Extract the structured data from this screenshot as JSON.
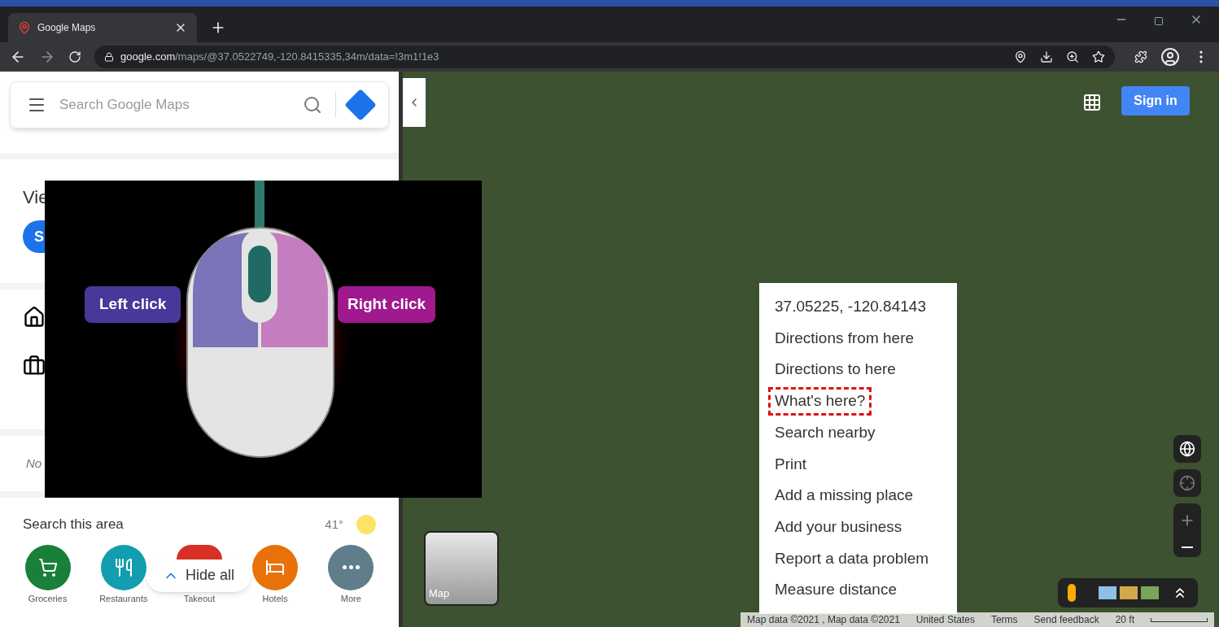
{
  "browser": {
    "tab": {
      "title": "Google Maps",
      "selected": true
    },
    "url": {
      "domain": "google.com",
      "path": "/maps/@37.0522749,-120.8415335,34m/data=!3m1!1e3"
    }
  },
  "sidebar": {
    "search": {
      "placeholder": "Search Google Maps"
    },
    "section_title": "Vie",
    "chip": "S",
    "note": "No",
    "area_title": "Search this area",
    "temperature": "41°",
    "hide_all": "Hide all",
    "categories": [
      {
        "label": "Groceries",
        "kind": "cart",
        "color": "#188038"
      },
      {
        "label": "Restaurants",
        "kind": "food",
        "color": "#129eaf"
      },
      {
        "label": "Takeout",
        "kind": "takeout",
        "color": "#d93025"
      },
      {
        "label": "Hotels",
        "kind": "bed",
        "color": "#e8710a"
      },
      {
        "label": "More",
        "kind": "more",
        "color": "#607d8b"
      }
    ]
  },
  "overlay": {
    "left_label": "Left click",
    "right_label": "Right click"
  },
  "map": {
    "sign_in": "Sign in",
    "layer_label": "Map",
    "context_menu": [
      {
        "label": "37.05225, -120.84143",
        "highlighted": false
      },
      {
        "label": "Directions from here",
        "highlighted": false
      },
      {
        "label": "Directions to here",
        "highlighted": false
      },
      {
        "label": "What's here?",
        "highlighted": true
      },
      {
        "label": "Search nearby",
        "highlighted": false
      },
      {
        "label": "Print",
        "highlighted": false
      },
      {
        "label": "Add a missing place",
        "highlighted": false
      },
      {
        "label": "Add your business",
        "highlighted": false
      },
      {
        "label": "Report a data problem",
        "highlighted": false
      },
      {
        "label": "Measure distance",
        "highlighted": false
      }
    ],
    "footer": [
      "Map data ©2021 , Map data ©2021",
      "United States",
      "Terms",
      "Send feedback"
    ],
    "scale": "20 ft"
  }
}
